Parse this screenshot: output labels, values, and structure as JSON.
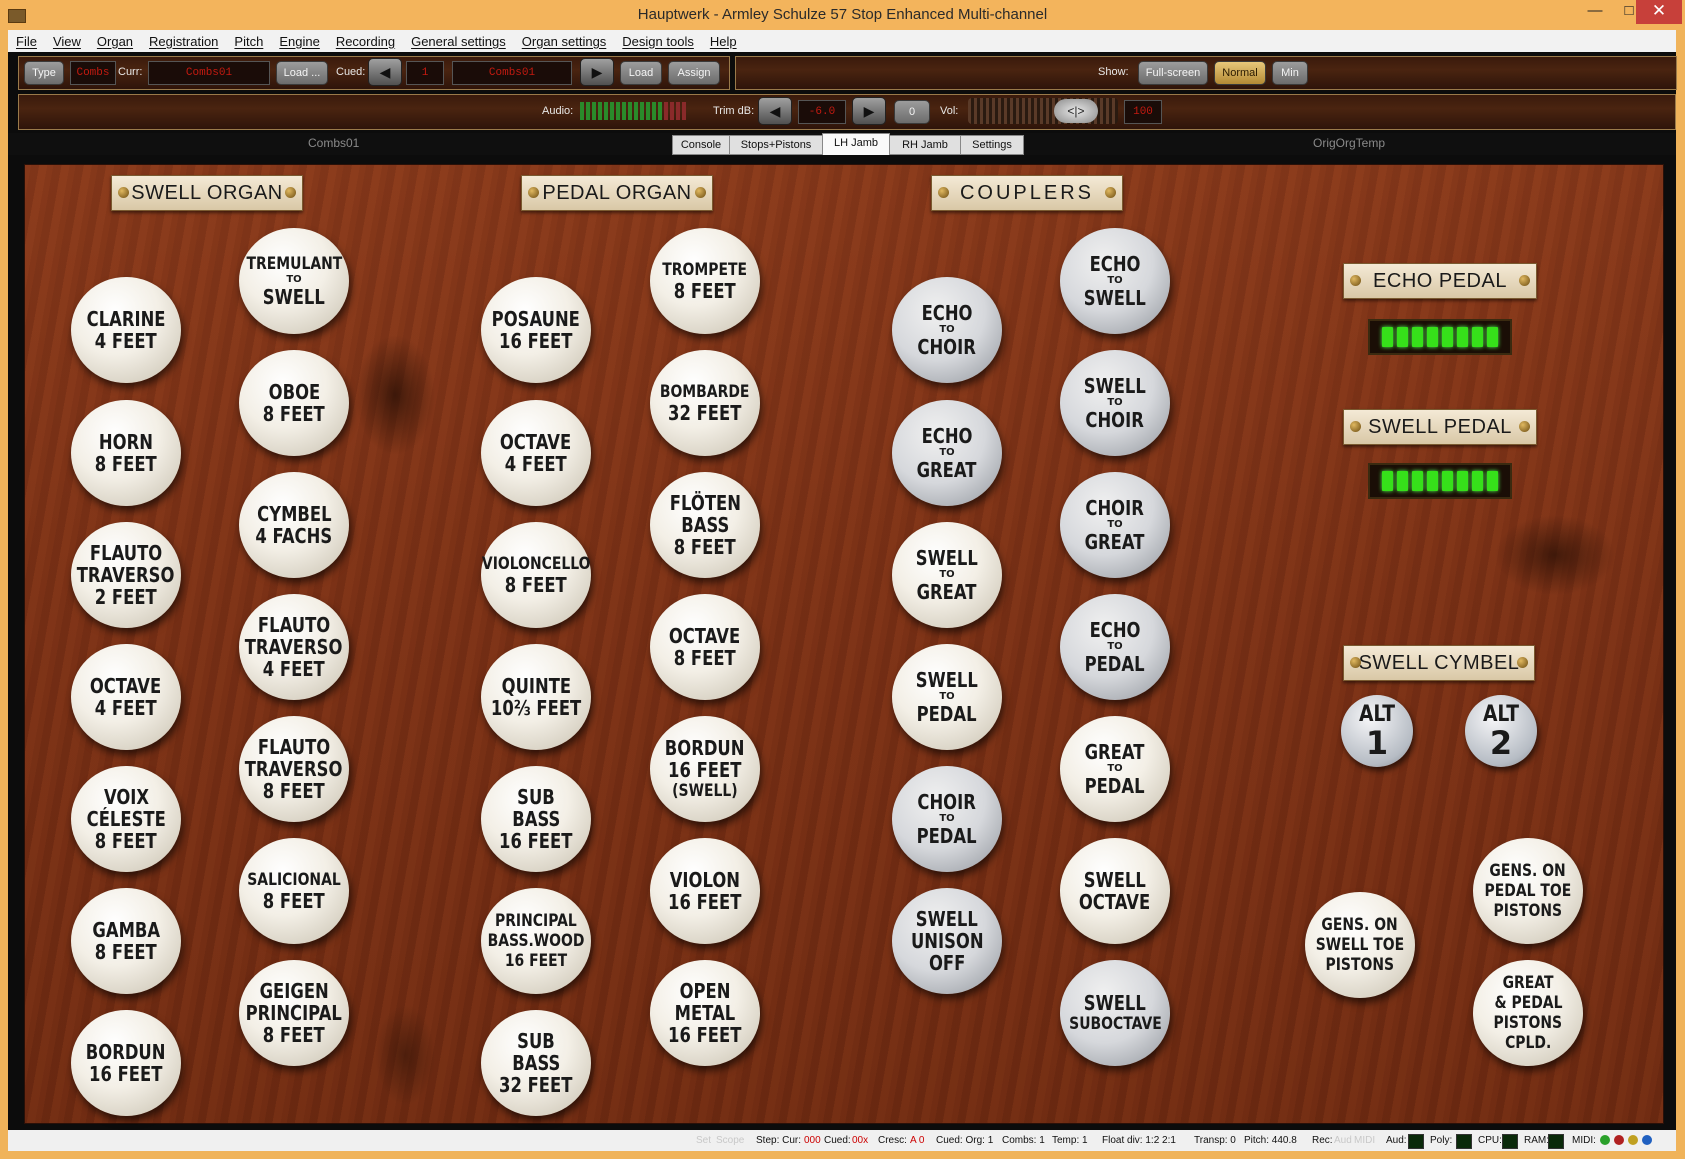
{
  "window": {
    "title": "Hauptwerk - Armley Schulze 57 Stop Enhanced Multi-channel",
    "minimize": "—",
    "maximize": "□",
    "close": "✕"
  },
  "menu": [
    "File",
    "View",
    "Organ",
    "Registration",
    "Pitch",
    "Engine",
    "Recording",
    "General settings",
    "Organ settings",
    "Design tools",
    "Help"
  ],
  "toolbar": {
    "type_btn": "Type",
    "combs_lcd": "Combs",
    "curr_label": "Curr:",
    "curr_value": "Combs01",
    "load_dots": "Load ...",
    "cued_label": "Cued:",
    "cued_num": "1",
    "cued_value": "Combs01",
    "load_btn": "Load",
    "assign_btn": "Assign",
    "show_label": "Show:",
    "fullscreen_btn": "Full-screen",
    "normal_btn": "Normal",
    "min_btn": "Min"
  },
  "toolbar2": {
    "audio_label": "Audio:",
    "trim_label": "Trim dB:",
    "trim_value": "-6.0",
    "zero_btn": "0",
    "vol_label": "Vol:",
    "vol_value": "100"
  },
  "tabs": {
    "left_text": "Combs01",
    "right_text": "OrigOrgTemp",
    "items": [
      "Console",
      "Stops+Pistons",
      "LH Jamb",
      "RH Jamb",
      "Settings"
    ],
    "active": "LH Jamb"
  },
  "sections": {
    "swell": "SWELL ORGAN",
    "pedal": "PEDAL ORGAN",
    "couplers": "COUPLERS",
    "echo_pedal": "ECHO PEDAL",
    "swell_pedal": "SWELL PEDAL",
    "swell_cymbel": "SWELL CYMBEL"
  },
  "stops": {
    "clarine": [
      "CLARINE",
      "4 FEET"
    ],
    "horn": [
      "HORN",
      "8 FEET"
    ],
    "flauto2": [
      "FLAUTO",
      "TRAVERSO",
      "2 FEET"
    ],
    "octave4s": [
      "OCTAVE",
      "4 FEET"
    ],
    "voix": [
      "VOIX",
      "CÉLESTE",
      "8 FEET"
    ],
    "gamba": [
      "GAMBA",
      "8 FEET"
    ],
    "bordun16s": [
      "BORDUN",
      "16 FEET"
    ],
    "tremulant": [
      "TREMULANT",
      "TO",
      "SWELL"
    ],
    "oboe": [
      "OBOE",
      "8 FEET"
    ],
    "cymbel": [
      "CYMBEL",
      "4 FACHS"
    ],
    "flauto4": [
      "FLAUTO",
      "TRAVERSO",
      "4 FEET"
    ],
    "flauto8": [
      "FLAUTO",
      "TRAVERSO",
      "8 FEET"
    ],
    "salicional": [
      "SALICIONAL",
      "8 FEET"
    ],
    "geigen": [
      "GEIGEN",
      "PRINCIPAL",
      "8 FEET"
    ],
    "posaune": [
      "POSAUNE",
      "16 FEET"
    ],
    "octave4p": [
      "OCTAVE",
      "4 FEET"
    ],
    "violoncello": [
      "VIOLONCELLO",
      "8 FEET"
    ],
    "quinte": [
      "QUINTE",
      "10⅔ FEET"
    ],
    "subbass16": [
      "SUB",
      "BASS",
      "16 FEET"
    ],
    "principal": [
      "PRINCIPAL",
      "BASS.WOOD",
      "16 FEET"
    ],
    "subbass32": [
      "SUB",
      "BASS",
      "32 FEET"
    ],
    "trompete": [
      "TROMPETE",
      "8 FEET"
    ],
    "bombarde": [
      "BOMBARDE",
      "32 FEET"
    ],
    "floeten": [
      "FLÖTEN",
      "BASS",
      "8 FEET"
    ],
    "octave8p": [
      "OCTAVE",
      "8 FEET"
    ],
    "bordun16p": [
      "BORDUN",
      "16 FEET",
      "(SWELL)"
    ],
    "violon": [
      "VIOLON",
      "16 FEET"
    ],
    "openmetal": [
      "OPEN",
      "METAL",
      "16 FEET"
    ],
    "echo_choir": [
      "ECHO",
      "TO",
      "CHOIR"
    ],
    "echo_great": [
      "ECHO",
      "TO",
      "GREAT"
    ],
    "swell_great": [
      "SWELL",
      "TO",
      "GREAT"
    ],
    "swell_pedal": [
      "SWELL",
      "TO",
      "PEDAL"
    ],
    "choir_pedal": [
      "CHOIR",
      "TO",
      "PEDAL"
    ],
    "swell_unison": [
      "SWELL",
      "UNISON",
      "OFF"
    ],
    "echo_swell": [
      "ECHO",
      "TO",
      "SWELL"
    ],
    "swell_choir": [
      "SWELL",
      "TO",
      "CHOIR"
    ],
    "choir_great": [
      "CHOIR",
      "TO",
      "GREAT"
    ],
    "echo_pedal": [
      "ECHO",
      "TO",
      "PEDAL"
    ],
    "great_pedal": [
      "GREAT",
      "TO",
      "PEDAL"
    ],
    "swell_octave": [
      "SWELL",
      "OCTAVE"
    ],
    "swell_suboctave": [
      "SWELL",
      "SUBOCTAVE"
    ],
    "gens_swell": [
      "GENS. ON",
      "SWELL TOE",
      "PISTONS"
    ],
    "gens_pedal": [
      "GENS. ON",
      "PEDAL TOE",
      "PISTONS"
    ],
    "great_pedal_cpld": [
      "GREAT",
      "& PEDAL",
      "PISTONS",
      "CPLD."
    ]
  },
  "alt": {
    "a1": [
      "ALT",
      "1"
    ],
    "a2": [
      "ALT",
      "2"
    ]
  },
  "status": {
    "set": "Set",
    "scope": "Scope",
    "step": "Step: Cur:",
    "step_cur": "000",
    "cued": "Cued:",
    "cued_val": "00x",
    "cresc": "Cresc:",
    "cresc_val": "A 0",
    "cued_org": "Cued: Org: 1",
    "combs": "Combs: 1",
    "temp": "Temp: 1",
    "float": "Float div: 1:2 2:1",
    "transp": "Transp: 0",
    "pitch": "Pitch: 440.8",
    "rec": "Rec:",
    "aud": "Aud",
    "midi_dim": "MIDI",
    "aud_label": "Aud:",
    "poly": "Poly:",
    "cpu": "CPU:",
    "ram": "RAM:",
    "midi": "MIDI:"
  },
  "colors": {
    "accent": "#f3b45c",
    "lcd_red": "#c21a10",
    "meter_green": "#36e01a"
  }
}
